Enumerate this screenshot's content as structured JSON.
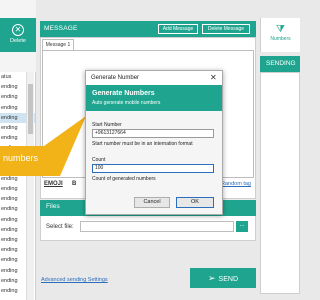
{
  "toolbar": {
    "delete_label": "Delete",
    "numbers_label": "Numbers"
  },
  "status_list": {
    "rows": [
      "atus",
      "ending",
      "ending",
      "ending",
      "ending",
      "ending",
      "ending",
      "ending",
      "ending",
      "ending",
      "ending",
      "ending",
      "ending",
      "ending",
      "ending",
      "ending",
      "ending",
      "ending",
      "ending",
      "ending",
      "ending",
      "ending"
    ]
  },
  "message_panel": {
    "title": "MESSAGE",
    "add_message_label": "Add Message",
    "delete_message_label": "Delete Message",
    "tab_label": "Message 1",
    "emoji_label": "EMOJI",
    "bold_label": "B",
    "random_tag_label": "Random tag"
  },
  "files_panel": {
    "title": "Files",
    "select_file_label": "Select file:",
    "browse_label": "..."
  },
  "advanced_link": "Advanced sending Settings",
  "send_label": "SEND",
  "sending_panel": {
    "title": "SENDING"
  },
  "callout": {
    "text": "numbers"
  },
  "dialog": {
    "title": "Generate Number",
    "close_glyph": "✕",
    "header_title": "Generate Numbers",
    "header_subtitle": "Auto generate mobile numbers",
    "start_label": "Start Number",
    "start_value": "+9613127664",
    "start_hint": "Start number must be in an internation format",
    "count_label": "Count",
    "count_value": "100",
    "count_hint": "Count of generated numbers",
    "cancel_label": "Cancel",
    "ok_label": "OK"
  },
  "colors": {
    "accent": "#1fa58f",
    "callout": "#f2b318",
    "link": "#2a6ebb"
  }
}
